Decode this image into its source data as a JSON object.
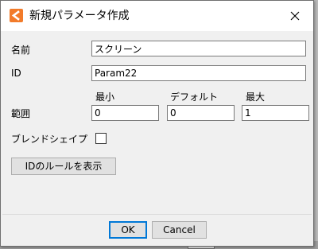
{
  "dialog": {
    "title": "新規パラメータ作成",
    "app_icon": "orange-app-logo-icon",
    "close_icon": "close-x-icon"
  },
  "form": {
    "name_label": "名前",
    "name_value": "スクリーン",
    "id_label": "ID",
    "id_value": "Param22",
    "range_label": "範囲",
    "min_label": "最小",
    "min_value": "0",
    "default_label": "デフォルト",
    "default_value": "0",
    "max_label": "最大",
    "max_value": "1",
    "blend_shape_label": "ブレンドシェイプ",
    "blend_shape_checked": false,
    "show_id_rules_label": "IDのルールを表示"
  },
  "footer": {
    "ok_label": "OK",
    "cancel_label": "Cancel"
  },
  "colors": {
    "accent": "#f27b2a",
    "default_button_border": "#0078d7"
  }
}
